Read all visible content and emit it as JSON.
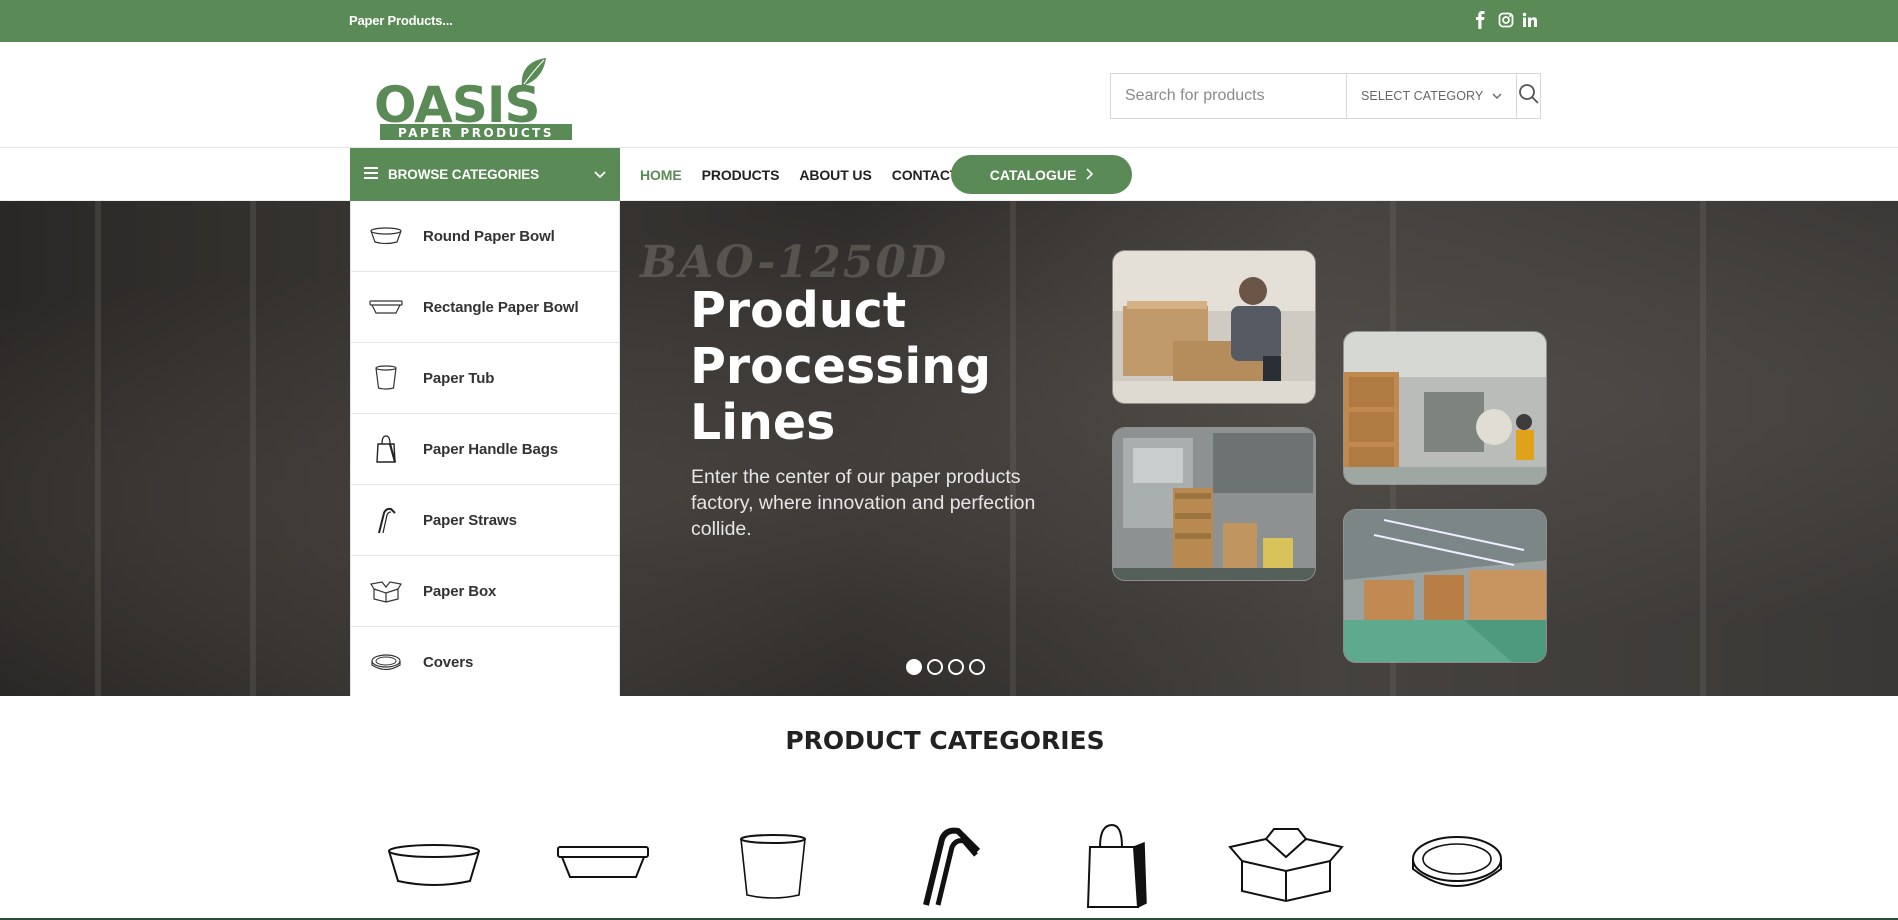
{
  "topbar": {
    "tagline": "Paper Products...",
    "social": [
      "facebook-icon",
      "instagram-icon",
      "linkedin-icon"
    ]
  },
  "header": {
    "logo_text": "OASIS",
    "logo_sub": "PAPER PRODUCTS",
    "search": {
      "placeholder": "Search for products",
      "category_label": "SELECT CATEGORY"
    }
  },
  "nav": {
    "browse_label": "BROWSE CATEGORIES",
    "items": [
      {
        "label": "HOME"
      },
      {
        "label": "PRODUCTS"
      },
      {
        "label": "ABOUT US"
      },
      {
        "label": "CONTACT"
      }
    ],
    "catalogue_label": "CATALOGUE"
  },
  "categories": [
    {
      "label": "Round Paper Bowl",
      "icon": "round-bowl-icon"
    },
    {
      "label": "Rectangle Paper Bowl",
      "icon": "rectangle-bowl-icon"
    },
    {
      "label": "Paper Tub",
      "icon": "tub-icon"
    },
    {
      "label": "Paper Handle Bags",
      "icon": "bag-icon"
    },
    {
      "label": "Paper Straws",
      "icon": "straw-icon"
    },
    {
      "label": "Paper Box",
      "icon": "box-icon"
    },
    {
      "label": "Covers",
      "icon": "cover-icon"
    }
  ],
  "hero": {
    "title": "Product Processing Lines",
    "subtitle": "Enter the center of our paper products factory, where innovation and perfection collide.",
    "background_text": "BAO-1250D",
    "slides": 4,
    "active_slide": 1
  },
  "product_categories": {
    "title": "PRODUCT CATEGORIES"
  },
  "colors": {
    "brand_green": "#5a8a55",
    "text_dark": "#222222"
  }
}
